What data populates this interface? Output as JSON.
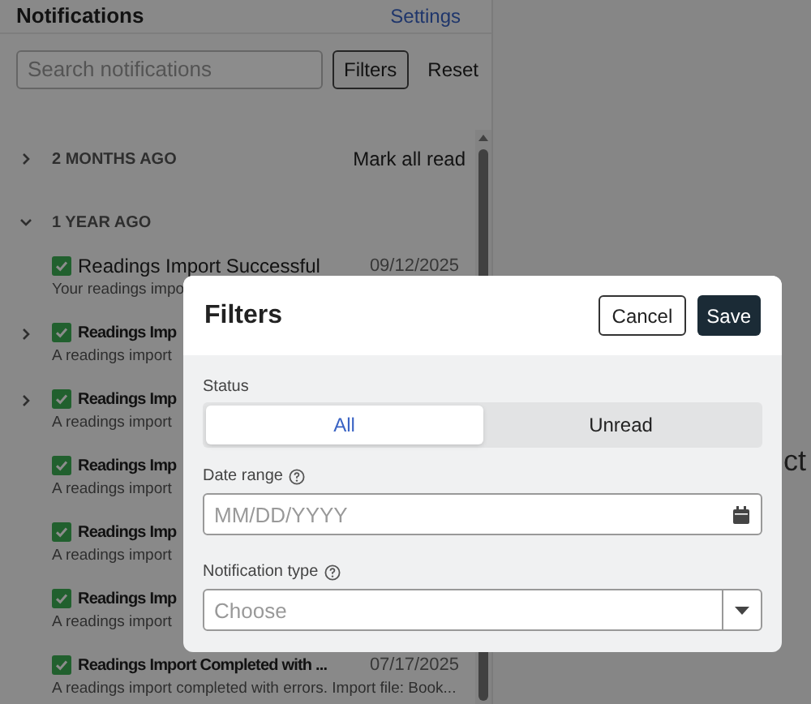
{
  "panel": {
    "title": "Notifications",
    "settings_link": "Settings",
    "search": {
      "placeholder": "Search notifications"
    },
    "filters_button": "Filters",
    "reset_button": "Reset",
    "groups": [
      {
        "label": "2 MONTHS AGO",
        "expanded": false,
        "action": "Mark all read"
      },
      {
        "label": "1 YEAR AGO",
        "expanded": true,
        "items": [
          {
            "title": "Readings Import Successful",
            "date": "09/12/2025",
            "description": "Your readings impo",
            "expandable": false,
            "unread": false
          },
          {
            "title": "Readings Imp",
            "description": "A readings import",
            "expandable": true,
            "unread": true
          },
          {
            "title": "Readings Imp",
            "description": "A readings import",
            "expandable": true,
            "unread": true
          },
          {
            "title": "Readings Imp",
            "description": "A readings import",
            "expandable": false,
            "unread": true
          },
          {
            "title": "Readings Imp",
            "description": "A readings import",
            "expandable": false,
            "unread": true
          },
          {
            "title": "Readings Imp",
            "description": "A readings import",
            "expandable": false,
            "unread": true
          },
          {
            "title": "Readings Import Completed with ...",
            "date": "07/17/2025",
            "description": "A readings import completed with errors. Import file: Book...",
            "expandable": false,
            "unread": true
          }
        ]
      }
    ]
  },
  "main": {
    "text": "ct"
  },
  "dialog": {
    "title": "Filters",
    "buttons": [
      {
        "label": "Cancel",
        "kind": "secondary"
      },
      {
        "label": "Save",
        "kind": "primary"
      }
    ],
    "status": {
      "label": "Status",
      "options": [
        {
          "label": "All",
          "selected": true
        },
        {
          "label": "Unread",
          "selected": false
        }
      ]
    },
    "date_range": {
      "label": "Date range",
      "placeholder": "MM/DD/YYYY"
    },
    "notification_type": {
      "label": "Notification type",
      "placeholder": "Choose"
    }
  }
}
